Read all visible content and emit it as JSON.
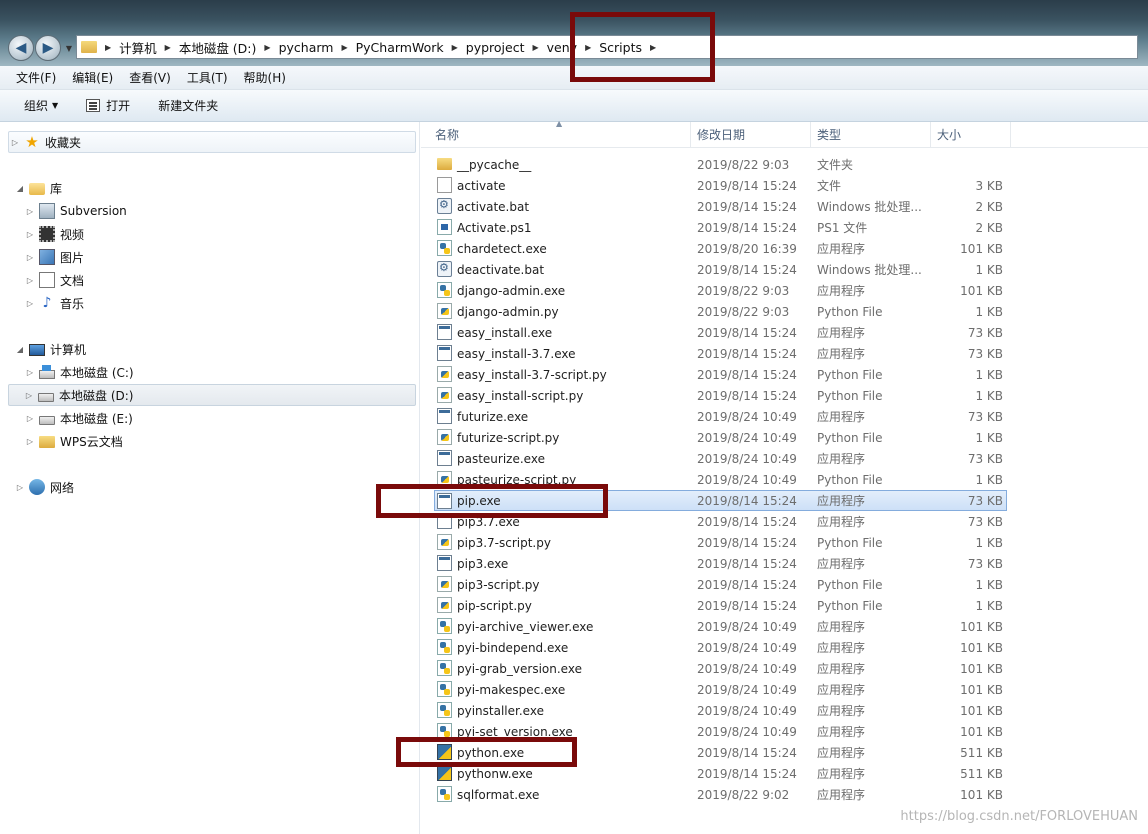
{
  "breadcrumb": [
    "计算机",
    "本地磁盘 (D:)",
    "pycharm",
    "PyCharmWork",
    "pyproject",
    "venv",
    "Scripts"
  ],
  "menu": [
    "文件(F)",
    "编辑(E)",
    "查看(V)",
    "工具(T)",
    "帮助(H)"
  ],
  "toolbar": {
    "organize": "组织",
    "open": "打开",
    "new_folder": "新建文件夹"
  },
  "nav": {
    "favorites": "收藏夹",
    "libraries": "库",
    "lib_items": [
      "Subversion",
      "视频",
      "图片",
      "文档",
      "音乐"
    ],
    "computer": "计算机",
    "drives": [
      "本地磁盘 (C:)",
      "本地磁盘 (D:)",
      "本地磁盘 (E:)",
      "WPS云文档"
    ],
    "network": "网络"
  },
  "columns": {
    "name": "名称",
    "date": "修改日期",
    "type": "类型",
    "size": "大小"
  },
  "files": [
    {
      "name": "__pycache__",
      "date": "2019/8/22 9:03",
      "type": "文件夹",
      "size": "",
      "icon": "folder-icon"
    },
    {
      "name": "activate",
      "date": "2019/8/14 15:24",
      "type": "文件",
      "size": "3 KB",
      "icon": "file-icon"
    },
    {
      "name": "activate.bat",
      "date": "2019/8/14 15:24",
      "type": "Windows 批处理...",
      "size": "2 KB",
      "icon": "batch-file-icon"
    },
    {
      "name": "Activate.ps1",
      "date": "2019/8/14 15:24",
      "type": "PS1 文件",
      "size": "2 KB",
      "icon": "powershell-file-icon"
    },
    {
      "name": "chardetect.exe",
      "date": "2019/8/20 16:39",
      "type": "应用程序",
      "size": "101 KB",
      "icon": "python-exe-icon"
    },
    {
      "name": "deactivate.bat",
      "date": "2019/8/14 15:24",
      "type": "Windows 批处理...",
      "size": "1 KB",
      "icon": "batch-file-icon"
    },
    {
      "name": "django-admin.exe",
      "date": "2019/8/22 9:03",
      "type": "应用程序",
      "size": "101 KB",
      "icon": "python-exe-icon"
    },
    {
      "name": "django-admin.py",
      "date": "2019/8/22 9:03",
      "type": "Python File",
      "size": "1 KB",
      "icon": "python-file-icon"
    },
    {
      "name": "easy_install.exe",
      "date": "2019/8/14 15:24",
      "type": "应用程序",
      "size": "73 KB",
      "icon": "window-exe-icon"
    },
    {
      "name": "easy_install-3.7.exe",
      "date": "2019/8/14 15:24",
      "type": "应用程序",
      "size": "73 KB",
      "icon": "window-exe-icon"
    },
    {
      "name": "easy_install-3.7-script.py",
      "date": "2019/8/14 15:24",
      "type": "Python File",
      "size": "1 KB",
      "icon": "python-file-icon"
    },
    {
      "name": "easy_install-script.py",
      "date": "2019/8/14 15:24",
      "type": "Python File",
      "size": "1 KB",
      "icon": "python-file-icon"
    },
    {
      "name": "futurize.exe",
      "date": "2019/8/24 10:49",
      "type": "应用程序",
      "size": "73 KB",
      "icon": "window-exe-icon"
    },
    {
      "name": "futurize-script.py",
      "date": "2019/8/24 10:49",
      "type": "Python File",
      "size": "1 KB",
      "icon": "python-file-icon"
    },
    {
      "name": "pasteurize.exe",
      "date": "2019/8/24 10:49",
      "type": "应用程序",
      "size": "73 KB",
      "icon": "window-exe-icon"
    },
    {
      "name": "pasteurize-script.py",
      "date": "2019/8/24 10:49",
      "type": "Python File",
      "size": "1 KB",
      "icon": "python-file-icon"
    },
    {
      "name": "pip.exe",
      "date": "2019/8/14 15:24",
      "type": "应用程序",
      "size": "73 KB",
      "icon": "window-exe-icon",
      "selected": true
    },
    {
      "name": "pip3.7.exe",
      "date": "2019/8/14 15:24",
      "type": "应用程序",
      "size": "73 KB",
      "icon": "window-exe-icon"
    },
    {
      "name": "pip3.7-script.py",
      "date": "2019/8/14 15:24",
      "type": "Python File",
      "size": "1 KB",
      "icon": "python-file-icon"
    },
    {
      "name": "pip3.exe",
      "date": "2019/8/14 15:24",
      "type": "应用程序",
      "size": "73 KB",
      "icon": "window-exe-icon"
    },
    {
      "name": "pip3-script.py",
      "date": "2019/8/14 15:24",
      "type": "Python File",
      "size": "1 KB",
      "icon": "python-file-icon"
    },
    {
      "name": "pip-script.py",
      "date": "2019/8/14 15:24",
      "type": "Python File",
      "size": "1 KB",
      "icon": "python-file-icon"
    },
    {
      "name": "pyi-archive_viewer.exe",
      "date": "2019/8/24 10:49",
      "type": "应用程序",
      "size": "101 KB",
      "icon": "python-exe-icon"
    },
    {
      "name": "pyi-bindepend.exe",
      "date": "2019/8/24 10:49",
      "type": "应用程序",
      "size": "101 KB",
      "icon": "python-exe-icon"
    },
    {
      "name": "pyi-grab_version.exe",
      "date": "2019/8/24 10:49",
      "type": "应用程序",
      "size": "101 KB",
      "icon": "python-exe-icon"
    },
    {
      "name": "pyi-makespec.exe",
      "date": "2019/8/24 10:49",
      "type": "应用程序",
      "size": "101 KB",
      "icon": "python-exe-icon"
    },
    {
      "name": "pyinstaller.exe",
      "date": "2019/8/24 10:49",
      "type": "应用程序",
      "size": "101 KB",
      "icon": "python-exe-icon"
    },
    {
      "name": "pyi-set_version.exe",
      "date": "2019/8/24 10:49",
      "type": "应用程序",
      "size": "101 KB",
      "icon": "python-exe-icon"
    },
    {
      "name": "python.exe",
      "date": "2019/8/14 15:24",
      "type": "应用程序",
      "size": "511 KB",
      "icon": "python-icon"
    },
    {
      "name": "pythonw.exe",
      "date": "2019/8/14 15:24",
      "type": "应用程序",
      "size": "511 KB",
      "icon": "python-icon"
    },
    {
      "name": "sqlformat.exe",
      "date": "2019/8/22 9:02",
      "type": "应用程序",
      "size": "101 KB",
      "icon": "python-exe-icon"
    }
  ],
  "watermark": "https://blog.csdn.net/FORLOVEHUAN"
}
